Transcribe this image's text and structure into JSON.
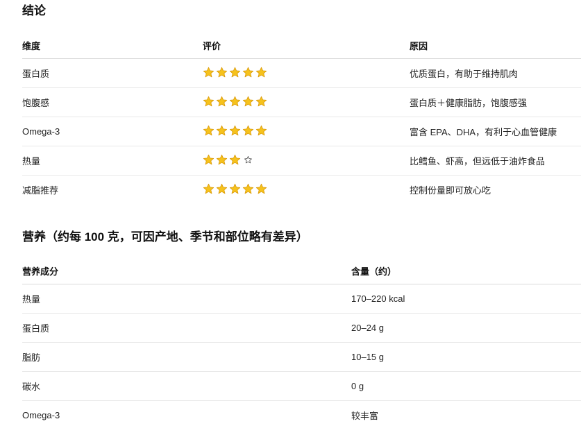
{
  "conclusion": {
    "title": "结论",
    "headers": [
      "维度",
      "评价",
      "原因"
    ],
    "rows": [
      {
        "dimension": "蛋白质",
        "rating_full": 5,
        "rating_empty": 0,
        "reason": "优质蛋白，有助于维持肌肉"
      },
      {
        "dimension": "饱腹感",
        "rating_full": 5,
        "rating_empty": 0,
        "reason": "蛋白质＋健康脂肪，饱腹感强"
      },
      {
        "dimension": "Omega-3",
        "rating_full": 5,
        "rating_empty": 0,
        "reason": "富含 EPA、DHA，有利于心血管健康"
      },
      {
        "dimension": "热量",
        "rating_full": 3,
        "rating_empty": 1,
        "reason": "比鳕鱼、虾高，但远低于油炸食品"
      },
      {
        "dimension": "减脂推荐",
        "rating_full": 5,
        "rating_empty": 0,
        "reason": "控制份量即可放心吃"
      }
    ]
  },
  "nutrition": {
    "title": "营养（约每 100 克，可因产地、季节和部位略有差异）",
    "headers": [
      "营养成分",
      "含量（约）"
    ],
    "rows": [
      {
        "name": "热量",
        "amount": "170–220 kcal"
      },
      {
        "name": "蛋白质",
        "amount": "20–24 g"
      },
      {
        "name": "脂肪",
        "amount": "10–15 g"
      },
      {
        "name": "碳水",
        "amount": "0 g"
      },
      {
        "name": "Omega-3",
        "amount": "较丰富"
      }
    ]
  },
  "icons": {
    "full_star": "star-filled-icon",
    "empty_star": "star-outline-icon"
  },
  "colors": {
    "star_fill": "#f6c21c",
    "star_stroke": "#d99a0b",
    "divider": "#e8e8e8"
  }
}
